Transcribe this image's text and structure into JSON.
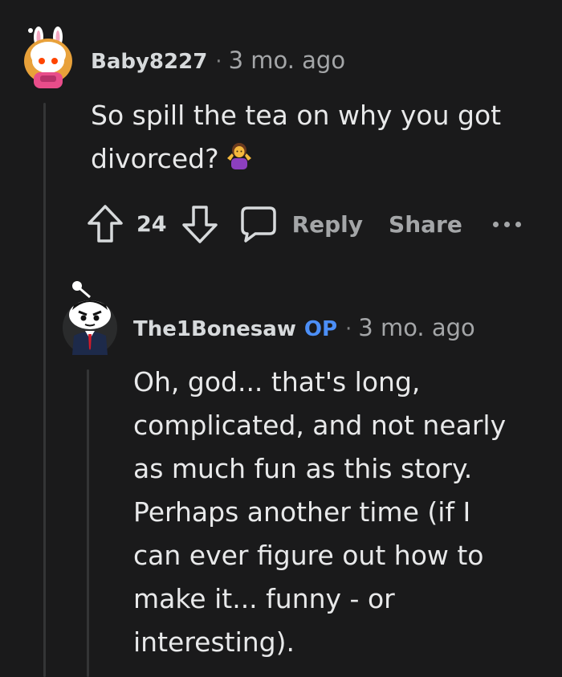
{
  "comments": [
    {
      "username": "Baby8227",
      "separator": "·",
      "timestamp": "3 mo. ago",
      "body_line1": "So spill the tea on why you got",
      "body_line2": "divorced?",
      "emoji": "person-shrugging-emoji",
      "score": "24",
      "reply_label": "Reply",
      "share_label": "Share"
    },
    {
      "username": "The1Bonesaw",
      "op_badge": "OP",
      "separator": "·",
      "timestamp": "3 mo. ago",
      "body_lines": [
        "Oh, god... that's long,",
        "complicated, and not nearly",
        "as much fun as this story.",
        "Perhaps another time (if I",
        "can ever figure out how to",
        "make it... funny - or",
        "interesting)."
      ]
    }
  ],
  "colors": {
    "background": "#1a1a1b",
    "op_badge": "#4c8ff7",
    "thread_line": "#343536"
  }
}
